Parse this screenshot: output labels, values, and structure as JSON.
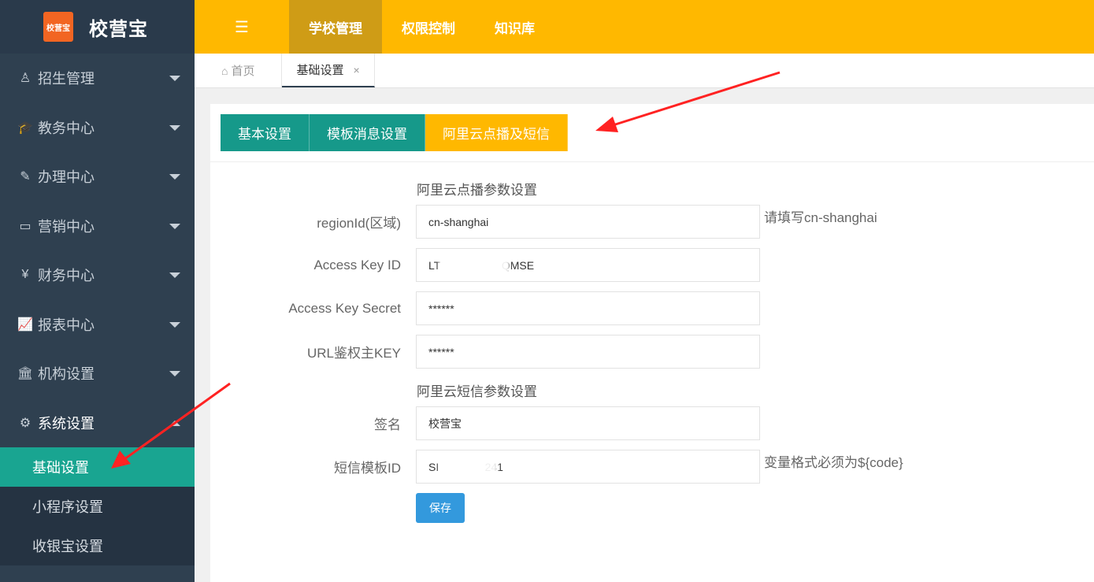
{
  "brand": {
    "logo_text": "校营宝",
    "logo_badge": "校营宝"
  },
  "sidebar": {
    "items": [
      {
        "label": "招生管理",
        "icon": "user-icon",
        "glyph": "♙"
      },
      {
        "label": "教务中心",
        "icon": "graduation-cap-icon",
        "glyph": "🎓"
      },
      {
        "label": "办理中心",
        "icon": "edit-icon",
        "glyph": "✎"
      },
      {
        "label": "营销中心",
        "icon": "laptop-icon",
        "glyph": "▭"
      },
      {
        "label": "财务中心",
        "icon": "yen-icon",
        "glyph": "¥"
      },
      {
        "label": "报表中心",
        "icon": "line-chart-icon",
        "glyph": "📈"
      },
      {
        "label": "机构设置",
        "icon": "bank-icon",
        "glyph": "🏛"
      },
      {
        "label": "系统设置",
        "icon": "cogs-icon",
        "glyph": "⚙"
      }
    ],
    "sub_items": [
      {
        "label": "基础设置"
      },
      {
        "label": "小程序设置"
      },
      {
        "label": "收银宝设置"
      }
    ]
  },
  "header": {
    "toggle_glyph": "☰",
    "nav": [
      {
        "label": "学校管理"
      },
      {
        "label": "权限控制"
      },
      {
        "label": "知识库"
      }
    ]
  },
  "tabs": {
    "home": "首页",
    "home_glyph": "⌂",
    "current": "基础设置",
    "close_glyph": "×"
  },
  "subtabs": [
    {
      "label": "基本设置"
    },
    {
      "label": "模板消息设置"
    },
    {
      "label": "阿里云点播及短信"
    }
  ],
  "form": {
    "vod_title": "阿里云点播参数设置",
    "sms_title": "阿里云短信参数设置",
    "fields": {
      "region": {
        "label": "regionId(区域)",
        "value": "cn-shanghai",
        "hint": "请填写cn-shanghai"
      },
      "access_key_id": {
        "label": "Access Key ID",
        "value": "LT                    QMSE"
      },
      "access_key_secret": {
        "label": "Access Key Secret",
        "value": "******"
      },
      "url_key": {
        "label": "URL鉴权主KEY",
        "value": "******"
      },
      "sign_name": {
        "label": "签名",
        "value": "校营宝"
      },
      "template_id": {
        "label": "短信模板ID",
        "value": "SI               241",
        "hint": "变量格式必须为${code}"
      }
    },
    "save_label": "保存"
  },
  "colors": {
    "sidebar": "#2f4050",
    "header": "#ffb800",
    "teal": "#16998a",
    "save": "#3399dd",
    "arrow": "#ff2222"
  }
}
